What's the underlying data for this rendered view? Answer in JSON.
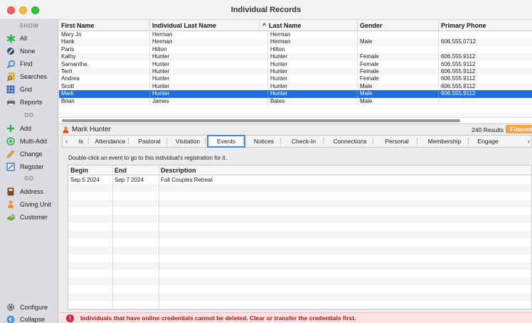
{
  "window": {
    "title": "Individual Records"
  },
  "sidebar": {
    "sections": {
      "show": "SHOW",
      "do": "DO",
      "go": "GO"
    },
    "show_items": [
      {
        "label": "All",
        "icon": "asterisk-icon"
      },
      {
        "label": "None",
        "icon": "none-icon"
      },
      {
        "label": "Find",
        "icon": "search-icon"
      },
      {
        "label": "Searches",
        "icon": "searches-icon"
      },
      {
        "label": "Grid",
        "icon": "grid-icon"
      },
      {
        "label": "Reports",
        "icon": "reports-icon"
      }
    ],
    "do_items": [
      {
        "label": "Add",
        "icon": "plus-icon"
      },
      {
        "label": "Multi-Add",
        "icon": "multi-add-icon"
      },
      {
        "label": "Change",
        "icon": "pencil-icon"
      },
      {
        "label": "Register",
        "icon": "register-icon"
      }
    ],
    "go_items": [
      {
        "label": "Address",
        "icon": "address-book-icon"
      },
      {
        "label": "Giving Unit",
        "icon": "giving-unit-icon"
      },
      {
        "label": "Customer",
        "icon": "customer-icon"
      }
    ],
    "bottom_items": [
      {
        "label": "Configure",
        "icon": "gear-icon"
      },
      {
        "label": "Collapse",
        "icon": "collapse-icon"
      }
    ]
  },
  "records_table": {
    "columns": [
      "First Name",
      "Individual Last Name",
      "Last Name",
      "Gender",
      "Primary Phone"
    ],
    "sort_indicator": "^",
    "rows": [
      [
        "Mary Jo",
        "Herman",
        "Herman",
        "",
        ""
      ],
      [
        "Hank",
        "Herman",
        "Herman",
        "Male",
        "606.555.0712"
      ],
      [
        "Paris",
        "Hilton",
        "Hilton",
        "",
        ""
      ],
      [
        "Kathy",
        "Hunter",
        "Hunter",
        "Female",
        "606.555.9112"
      ],
      [
        "Samantha",
        "Hunter",
        "Hunter",
        "Female",
        "606.555.9112"
      ],
      [
        "Terri",
        "Hunter",
        "Hunter",
        "Female",
        "606.555.9112"
      ],
      [
        "Andrea",
        "Hunter",
        "Hunter",
        "Female",
        "606.555.9112"
      ],
      [
        "Scott",
        "Hunter",
        "Hunter",
        "Male",
        "606.555.9112"
      ],
      [
        "Mark",
        "Hunter",
        "Hunter",
        "Male",
        "606.555.9112"
      ],
      [
        "Brian",
        "James",
        "Bates",
        "Male",
        ""
      ]
    ],
    "selected_row": 8
  },
  "person": {
    "name": "Mark Hunter",
    "results": "240 Results",
    "filter_badge": "Filtered"
  },
  "tabs": {
    "items": [
      "ls",
      "Attendance",
      "Pastoral",
      "Visitation",
      "Events",
      "Notices",
      "Check-In",
      "Connections",
      "Personal",
      "Membership",
      "Engage"
    ],
    "active": "Events",
    "left_arrow": "‹",
    "right_arrow": "›"
  },
  "events": {
    "hint": "Double-click an event to go to this individual's registration for it.",
    "columns": [
      "Begin",
      "End",
      "Description"
    ],
    "rows": [
      [
        "Sep 5 2024",
        "Sep 7 2024",
        "Fall Couples Retreat"
      ]
    ]
  },
  "error": {
    "icon": "!",
    "message": "Individuals that have online credentials cannot be deleted. Clear or transfer the credentials first."
  },
  "colors": {
    "selection": "#1f6ee0",
    "error_text": "#b4161b",
    "filtered_badge": "#f5a53a",
    "active_tab_border": "#3a8ee8"
  }
}
